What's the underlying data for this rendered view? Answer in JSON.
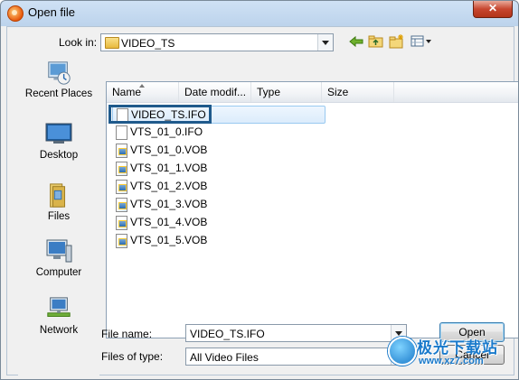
{
  "window": {
    "title": "Open file",
    "close_label": "✕"
  },
  "look_in": {
    "label": "Look in:",
    "value": "VIDEO_TS"
  },
  "toolbar": {
    "icons": [
      "back-arrow-icon",
      "up-folder-icon",
      "new-folder-icon",
      "view-menu-icon"
    ]
  },
  "places": [
    {
      "label": "Recent Places",
      "icon": "recent-places-icon"
    },
    {
      "label": "Desktop",
      "icon": "desktop-icon"
    },
    {
      "label": "Files",
      "icon": "files-icon"
    },
    {
      "label": "Computer",
      "icon": "computer-icon"
    },
    {
      "label": "Network",
      "icon": "network-icon"
    }
  ],
  "columns": [
    "Name",
    "Date modif...",
    "Type",
    "Size"
  ],
  "files": [
    {
      "name": "VIDEO_TS.IFO",
      "kind": "doc",
      "selected": true
    },
    {
      "name": "VTS_01_0.IFO",
      "kind": "doc",
      "selected": false
    },
    {
      "name": "VTS_01_0.VOB",
      "kind": "vob",
      "selected": false
    },
    {
      "name": "VTS_01_1.VOB",
      "kind": "vob",
      "selected": false
    },
    {
      "name": "VTS_01_2.VOB",
      "kind": "vob",
      "selected": false
    },
    {
      "name": "VTS_01_3.VOB",
      "kind": "vob",
      "selected": false
    },
    {
      "name": "VTS_01_4.VOB",
      "kind": "vob",
      "selected": false
    },
    {
      "name": "VTS_01_5.VOB",
      "kind": "vob",
      "selected": false
    }
  ],
  "file_name": {
    "label": "File name:",
    "value": "VIDEO_TS.IFO"
  },
  "file_type": {
    "label": "Files of type:",
    "value": "All Video Files"
  },
  "buttons": {
    "open": "Open",
    "cancel": "Cancel"
  },
  "watermark": {
    "text": "极光下载站",
    "url": "www.xz7.com"
  },
  "colors": {
    "focus_border": "#1f5a8c",
    "selection": "#dcecfc",
    "watermark": "#1a7acb"
  }
}
